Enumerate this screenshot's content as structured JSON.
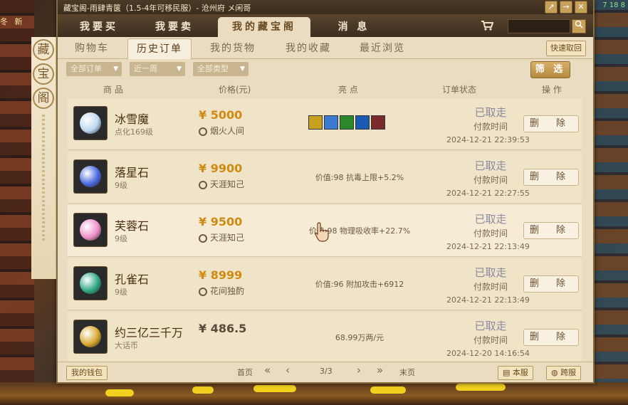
{
  "background": {
    "left_text": [
      "冬",
      "新"
    ],
    "right_nums": "7 18 8"
  },
  "window": {
    "title": "藏宝阁-雨肆青箧（1.5-4年可移民服）- 沧州府 メ闲哥",
    "buttons": [
      "↗",
      "→",
      "✕"
    ]
  },
  "main_tabs": [
    {
      "label": "我要买",
      "active": false
    },
    {
      "label": "我要卖",
      "active": false
    },
    {
      "label": "我的藏宝阁",
      "active": true
    },
    {
      "label": "消 息",
      "active": false
    }
  ],
  "seal": [
    "藏",
    "宝",
    "阁"
  ],
  "sub_tabs": [
    {
      "label": "购物车",
      "active": false
    },
    {
      "label": "历史订单",
      "active": true
    },
    {
      "label": "我的货物",
      "active": false
    },
    {
      "label": "我的收藏",
      "active": false
    },
    {
      "label": "最近浏览",
      "active": false
    }
  ],
  "quick_buy": "快速取回",
  "filters": {
    "orders": "全部订单",
    "period": "近一周",
    "type": "全部类型",
    "button": "筛 选"
  },
  "columns": {
    "item": "商 品",
    "price": "价格(元)",
    "highlight": "亮 点",
    "status": "订单状态",
    "action": "操 作"
  },
  "rows": [
    {
      "name": "冰雪魔",
      "sub": "点化169级",
      "price": "¥ 5000",
      "seller": "烟火人间",
      "highlight": "",
      "skills": [
        "#c8a020",
        "#3a7ad0",
        "#2a8a2a",
        "#1a5ab0",
        "#7a2a2a"
      ],
      "status": "已取走",
      "pay_label": "付款时间",
      "time": "2024-12-21 22:39:53",
      "delete": "删 除",
      "gem": "#bcd8f0"
    },
    {
      "name": "落星石",
      "sub": "9级",
      "price": "¥ 9900",
      "seller": "天涯知己",
      "highlight": "价值:98 抗毒上限+5.2%",
      "skills": [],
      "status": "已取走",
      "pay_label": "付款时间",
      "time": "2024-12-21 22:27:55",
      "delete": "删 除",
      "gem": "#4a6ae0"
    },
    {
      "name": "芙蓉石",
      "sub": "9级",
      "price": "¥ 9500",
      "seller": "天涯知己",
      "highlight": "价值:98 物理吸收率+22.7%",
      "skills": [],
      "status": "已取走",
      "pay_label": "付款时间",
      "time": "2024-12-21 22:13:49",
      "delete": "删 除",
      "gem": "#f090c8"
    },
    {
      "name": "孔雀石",
      "sub": "9级",
      "price": "¥ 8999",
      "seller": "花间独酌",
      "highlight": "价值:96 附加攻击+6912",
      "skills": [],
      "status": "已取走",
      "pay_label": "付款时间",
      "time": "2024-12-21 22:13:49",
      "delete": "删 除",
      "gem": "#30a888"
    },
    {
      "name": "约三亿三千万",
      "sub": "大话币",
      "price": "¥ 486.5",
      "seller": "",
      "highlight": "68.99万两/元",
      "skills": [],
      "status": "已取走",
      "pay_label": "付款时间",
      "time": "2024-12-20 14:16:54",
      "delete": "删 除",
      "gem": "#d8a830"
    }
  ],
  "footer": {
    "wallet": "我的钱包",
    "first": "首页",
    "page": "3/3",
    "last": "末页",
    "server": "本服",
    "cross": "跨服"
  },
  "colors": {
    "accent": "#d08a10",
    "panel": "#e9dcc0",
    "tab_bar": "#3c2e1f"
  }
}
